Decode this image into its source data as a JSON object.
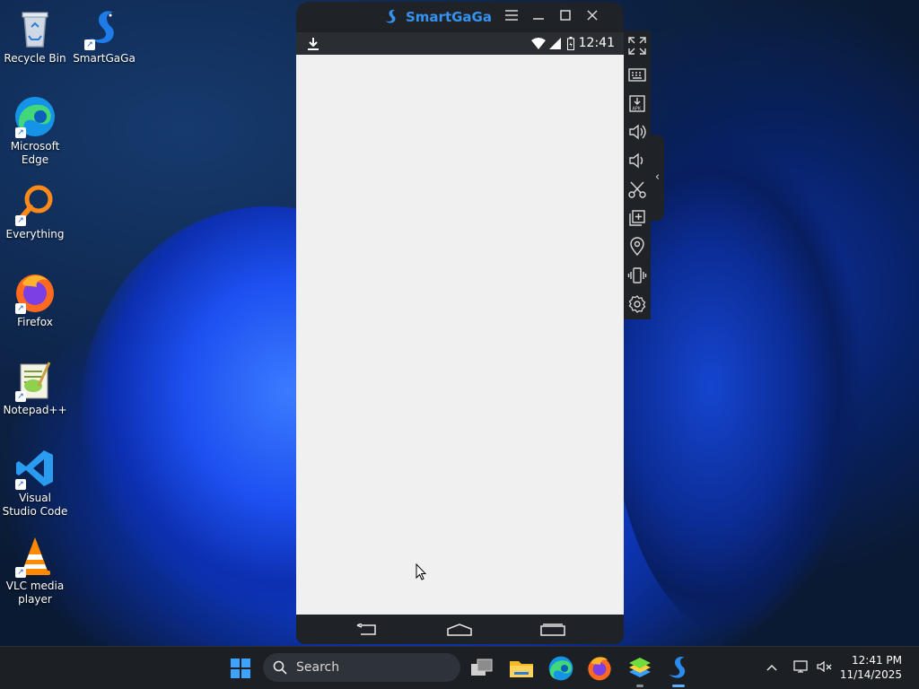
{
  "desktop": {
    "icons": [
      {
        "label": "Recycle Bin",
        "icon": "recycle-bin-icon"
      },
      {
        "label": "SmartGaGa",
        "icon": "smartgaga-icon"
      },
      {
        "label": "Microsoft Edge",
        "icon": "edge-icon"
      },
      {
        "label": "Everything",
        "icon": "everything-search-icon"
      },
      {
        "label": "Firefox",
        "icon": "firefox-icon"
      },
      {
        "label": "Notepad++",
        "icon": "notepadpp-icon"
      },
      {
        "label": "Visual Studio Code",
        "icon": "vscode-icon"
      },
      {
        "label": "VLC media player",
        "icon": "vlc-icon"
      }
    ]
  },
  "emulator": {
    "title": "SmartGaGa",
    "status_time": "12:41",
    "colors": {
      "brand": "#3592f2",
      "frame": "#1f2226",
      "screen": "#f0f0f0"
    },
    "toolbar": [
      "fullscreen-icon",
      "keyboard-icon",
      "apk-install-icon",
      "volume-up-icon",
      "volume-down-icon",
      "screenshot-scissors-icon",
      "multi-instance-icon",
      "location-icon",
      "shake-icon",
      "settings-icon"
    ]
  },
  "taskbar": {
    "search_placeholder": "Search",
    "time": "12:41 PM",
    "date": "11/14/2025",
    "apps": [
      "windows-start-icon",
      "task-view-icon",
      "file-explorer-icon",
      "edge-icon",
      "firefox-icon",
      "bluestacks-icon",
      "smartgaga-icon"
    ],
    "accent": "#5ab0ff"
  }
}
